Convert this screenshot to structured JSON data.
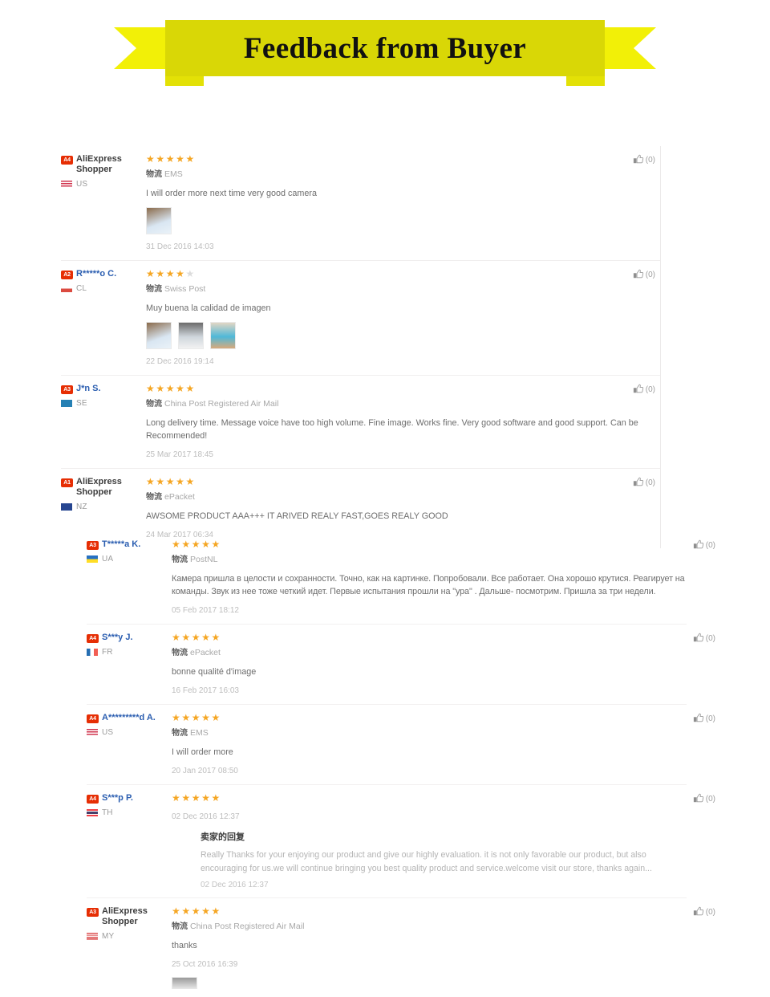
{
  "banner": {
    "title": "Feedback from Buyer"
  },
  "icons": {
    "thumb_up": "thumb-up-icon",
    "logistics_glyph": "物流"
  },
  "reviews": [
    {
      "rank": "A4",
      "user": "AliExpress Shopper",
      "country": "US",
      "rating": 5,
      "shipping": "EMS",
      "text": "I will order more next time very good camera",
      "photos": 1,
      "date": "31 Dec 2016 14:03",
      "helpful": "(0)",
      "group": "a"
    },
    {
      "rank": "A2",
      "user": "R*****o C.",
      "country": "CL",
      "rating": 4,
      "shipping": "Swiss Post",
      "text": "Muy buena la calidad de imagen",
      "photos": 3,
      "date": "22 Dec 2016 19:14",
      "helpful": "(0)",
      "group": "a"
    },
    {
      "rank": "A3",
      "user": "J*n S.",
      "country": "SE",
      "rating": 5,
      "shipping": "China Post Registered Air Mail",
      "text": "Long delivery time. Message voice have too high volume. Fine image. Works fine. Very good software and good support. Can be Recommended!",
      "photos": 0,
      "date": "25 Mar 2017 18:45",
      "helpful": "(0)",
      "group": "a"
    },
    {
      "rank": "A1",
      "user": "AliExpress Shopper",
      "country": "NZ",
      "rating": 5,
      "shipping": "ePacket",
      "text": "AWSOME PRODUCT AAA+++ IT ARIVED REALY FAST,GOES REALY GOOD",
      "photos": 0,
      "date": "24 Mar 2017 06:34",
      "helpful": "(0)",
      "group": "a"
    },
    {
      "rank": "A3",
      "user": "T*****a K.",
      "country": "UA",
      "rating": 5,
      "shipping": "PostNL",
      "text": "Камера пришла в целости и сохранности. Точно, как на картинке. Попробовали. Все работает. Она хорошо крутися. Реагирует на команды. Звук из нее тоже четкий идет. Первые испытания прошли на \"ура\" . Дальше- посмотрим. Пришла за три недели.",
      "photos": 0,
      "date": "05 Feb 2017 18:12",
      "helpful": "(0)",
      "group": "b"
    },
    {
      "rank": "A4",
      "user": "S***y J.",
      "country": "FR",
      "rating": 5,
      "shipping": "ePacket",
      "text": "bonne qualité d'image",
      "photos": 0,
      "date": "16 Feb 2017 16:03",
      "helpful": "(0)",
      "group": "b"
    },
    {
      "rank": "A4",
      "user": "A*********d A.",
      "country": "US",
      "rating": 5,
      "shipping": "EMS",
      "text": "I will order more",
      "photos": 0,
      "date": "20 Jan 2017 08:50",
      "helpful": "(0)",
      "group": "b"
    },
    {
      "rank": "A4",
      "user": "S***p P.",
      "country": "TH",
      "rating": 5,
      "shipping": "",
      "text": "",
      "photos": 0,
      "date": "02 Dec 2016 12:37",
      "helpful": "(0)",
      "group": "b",
      "reply": {
        "title": "卖家的回复",
        "body": "Really Thanks for your enjoying our product and give our highly evaluation. it is not only favorable our product, but also encouraging for us.we will continue bringing you best quality product and service.welcome visit our store, thanks again...",
        "date": "02 Dec 2016 12:37"
      }
    },
    {
      "rank": "A3",
      "user": "AliExpress Shopper",
      "country": "MY",
      "rating": 5,
      "shipping": "China Post Registered Air Mail",
      "text": "thanks",
      "photos": 0,
      "photos_cut": 1,
      "date": "25 Oct 2016 16:39",
      "helpful": "(0)",
      "group": "b"
    }
  ],
  "colors": {
    "banner_bg": "#d9d706",
    "banner_tail": "#f2f007",
    "badge": "#e62e04",
    "star": "#f5a623",
    "star_off": "#dcdcdc",
    "username": "#2a5db0",
    "body_text": "#6d6d6d",
    "muted": "#bdbdbd"
  }
}
